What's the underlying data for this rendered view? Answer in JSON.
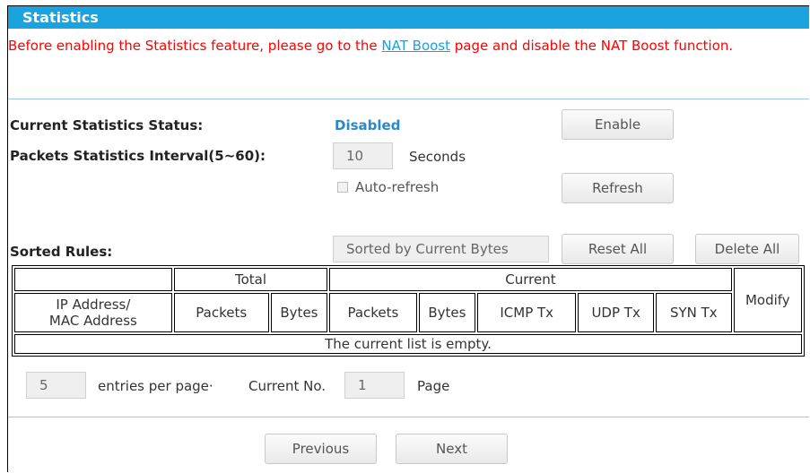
{
  "header": {
    "title": "Statistics"
  },
  "warning": {
    "text_before": "Before enabling the Statistics feature, please go to the ",
    "link": "NAT Boost",
    "text_after": " page and disable the NAT Boost function."
  },
  "status": {
    "label": "Current Statistics Status:",
    "value": "Disabled",
    "enable_button": "Enable"
  },
  "interval": {
    "label": "Packets Statistics Interval(5~60):",
    "value": "10",
    "unit": "Seconds"
  },
  "auto_refresh": {
    "label": "Auto-refresh",
    "checked": false
  },
  "refresh_button": "Refresh",
  "sorted": {
    "label": "Sorted Rules:",
    "value": "Sorted by Current Bytes",
    "reset_button": "Reset All",
    "delete_button": "Delete All"
  },
  "table": {
    "group_total": "Total",
    "group_current": "Current",
    "col_ip": "IP Address/\nMAC Address",
    "col_total_packets": "Packets",
    "col_total_bytes": "Bytes",
    "col_cur_packets": "Packets",
    "col_cur_bytes": "Bytes",
    "col_icmp": "ICMP Tx",
    "col_udp": "UDP Tx",
    "col_syn": "SYN Tx",
    "col_modify": "Modify",
    "empty_message": "The current list is empty."
  },
  "pagination": {
    "entries_value": "5",
    "entries_label": "entries per page·",
    "current_label": "Current No.",
    "current_value": "1",
    "page_label": "Page",
    "previous_button": "Previous",
    "next_button": "Next"
  },
  "colors": {
    "header_bg": "#1ba3e0",
    "warning_text": "#ff0000",
    "status_text": "#2a87c8",
    "link": "#1aa0e0"
  }
}
